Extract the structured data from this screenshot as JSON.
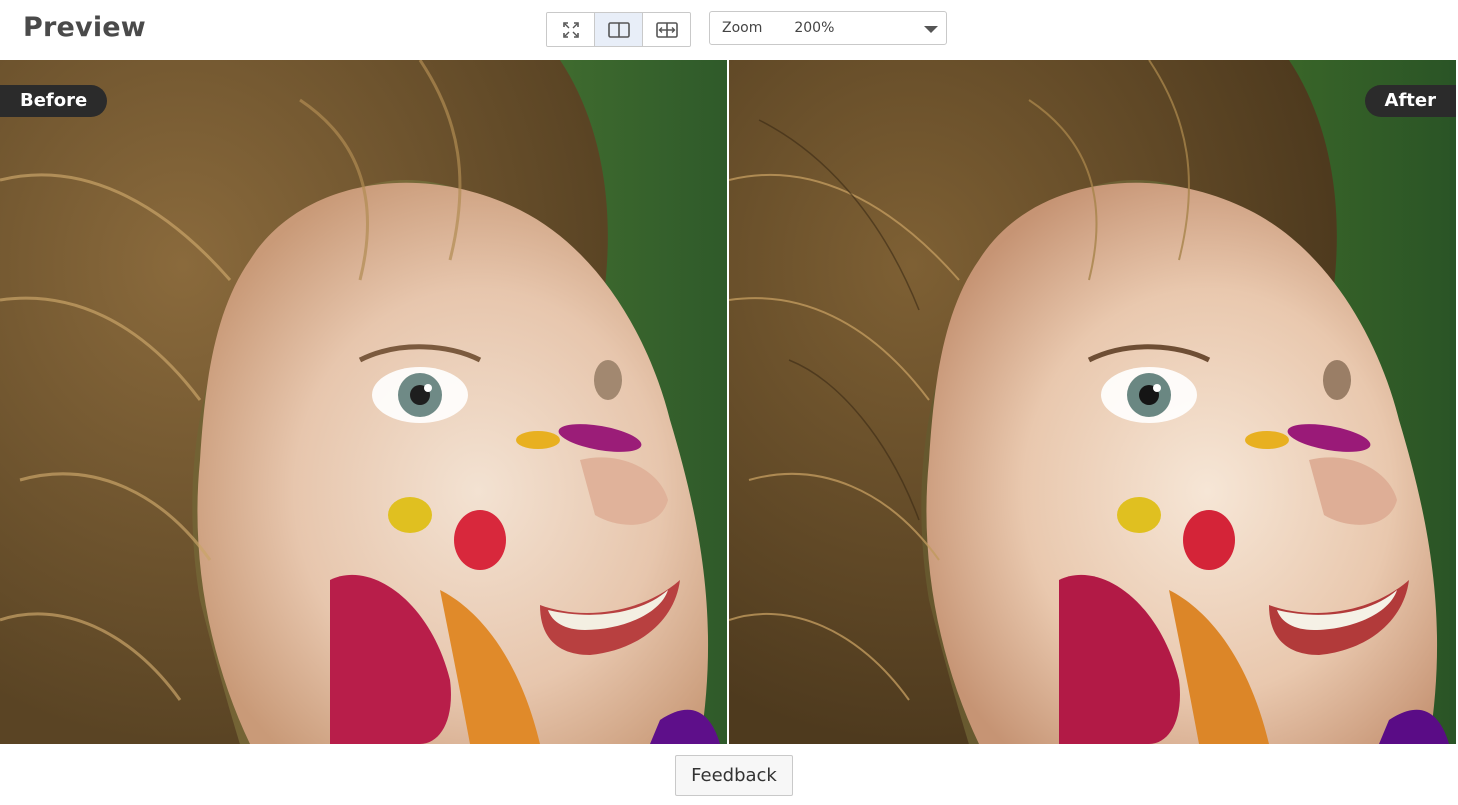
{
  "header": {
    "title": "Preview",
    "view_modes": [
      {
        "name": "fullscreen",
        "icon": "expand-icon",
        "active": false
      },
      {
        "name": "split",
        "icon": "split-view-icon",
        "active": true
      },
      {
        "name": "compare",
        "icon": "compare-slider-icon",
        "active": false
      }
    ],
    "zoom": {
      "label": "Zoom",
      "value": "200%"
    }
  },
  "viewer": {
    "before_label": "Before",
    "after_label": "After"
  },
  "footer": {
    "feedback_label": "Feedback"
  },
  "colors": {
    "badge_bg": "#2b2b2b",
    "active_toggle_bg": "#e8eef8",
    "border": "#c9c9c9"
  }
}
